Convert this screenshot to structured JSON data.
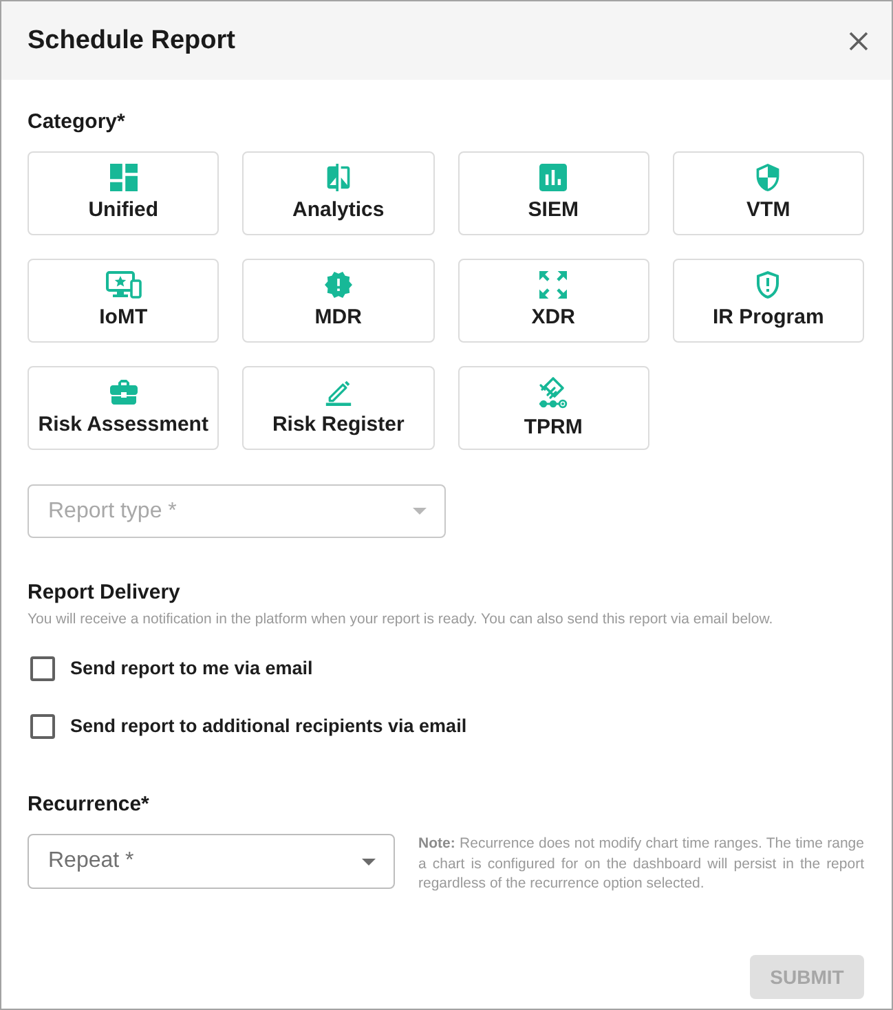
{
  "dialog": {
    "title": "Schedule Report"
  },
  "category": {
    "label": "Category*",
    "tiles": [
      {
        "label": "Unified",
        "selected": false
      },
      {
        "label": "Analytics",
        "selected": false
      },
      {
        "label": "SIEM",
        "selected": false
      },
      {
        "label": "VTM",
        "selected": false
      },
      {
        "label": "IoMT",
        "selected": false
      },
      {
        "label": "MDR",
        "selected": false
      },
      {
        "label": "XDR",
        "selected": false
      },
      {
        "label": "IR Program",
        "selected": false
      },
      {
        "label": "Risk Assessment",
        "selected": false
      },
      {
        "label": "Risk Register",
        "selected": false
      },
      {
        "label": "TPRM",
        "selected": false
      }
    ]
  },
  "report_type": {
    "placeholder": "Report type *",
    "disabled": true
  },
  "delivery": {
    "title": "Report Delivery",
    "description": "You will receive a notification in the platform when your report is ready. You can also send this report via email below.",
    "options": [
      {
        "label": "Send report to me via email",
        "checked": false
      },
      {
        "label": "Send report to additional recipients via email",
        "checked": false
      }
    ]
  },
  "recurrence": {
    "label": "Recurrence*",
    "repeat": {
      "placeholder": "Repeat *",
      "disabled": false
    },
    "note": "**Note:** Recurrence does not modify chart time ranges. The time range a chart is configured for on the dashboard will persist in the report regardless of the recurrence option selected."
  },
  "submit": {
    "label": "SUBMIT",
    "disabled": true
  }
}
